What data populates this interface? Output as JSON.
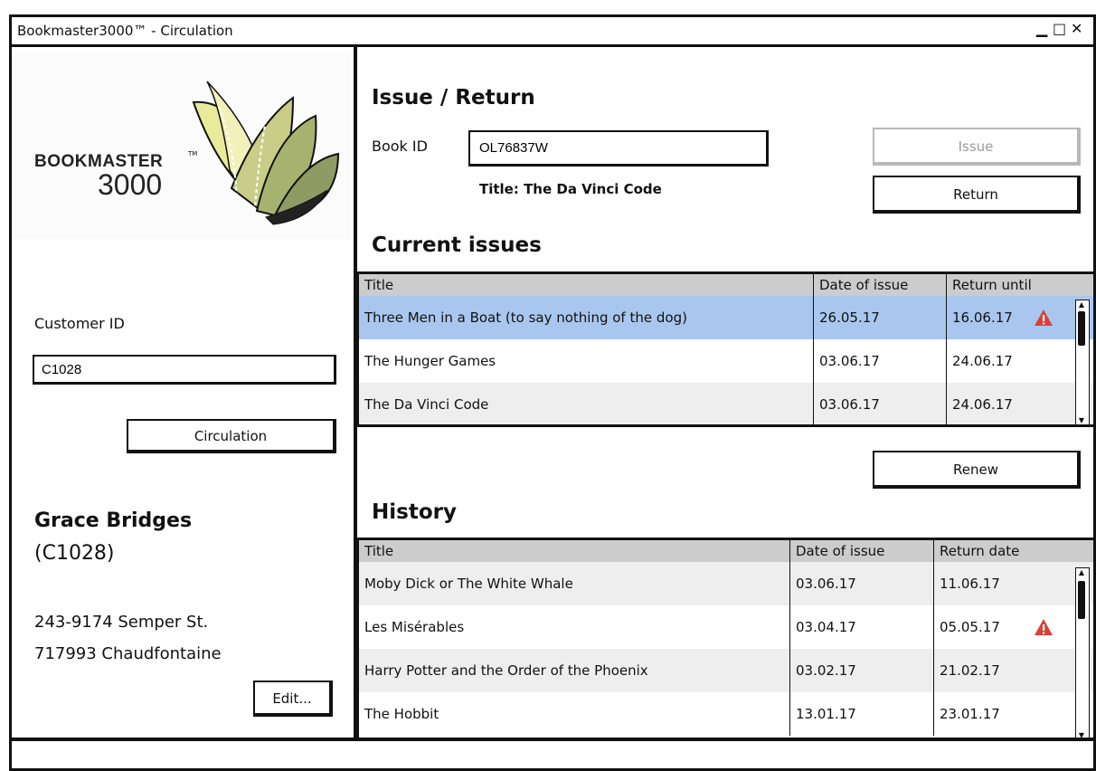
{
  "window": {
    "title": "Bookmaster3000™ - Circulation",
    "controls": [
      "▁",
      "□",
      "✕"
    ]
  },
  "logo": {
    "word": "BOOKMASTER",
    "tm": "TM",
    "number": "3000"
  },
  "customer": {
    "id_label": "Customer ID",
    "id_value": "C1028",
    "circulation_button": "Circulation",
    "name": "Grace Bridges",
    "id_display": "(C1028)",
    "address_line1": "243-9174 Semper St.",
    "address_line2": "717993 Chaudfontaine",
    "edit_button": "Edit..."
  },
  "issue_return": {
    "heading": "Issue / Return",
    "book_id_label": "Book ID",
    "book_id_value": "OL76837W",
    "title_text": "Title: The Da Vinci Code",
    "issue_button": "Issue",
    "return_button": "Return"
  },
  "current_issues": {
    "heading": "Current issues",
    "columns": [
      "Title",
      "Date of issue",
      "Return until"
    ],
    "rows": [
      {
        "title": "Three Men in a Boat (to say nothing of the dog)",
        "issued": "26.05.17",
        "due": "16.06.17",
        "overdue": true,
        "selected": true
      },
      {
        "title": "The Hunger Games",
        "issued": "03.06.17",
        "due": "24.06.17",
        "overdue": false,
        "selected": false
      },
      {
        "title": "The Da Vinci Code",
        "issued": "03.06.17",
        "due": "24.06.17",
        "overdue": false,
        "selected": false
      }
    ],
    "renew_button": "Renew"
  },
  "history": {
    "heading": "History",
    "columns": [
      "Title",
      "Date of issue",
      "Return date"
    ],
    "rows": [
      {
        "title": "Moby Dick or The White Whale",
        "issued": "03.06.17",
        "returned": "11.06.17",
        "overdue": false
      },
      {
        "title": "Les Misérables",
        "issued": "03.04.17",
        "returned": "05.05.17",
        "overdue": true
      },
      {
        "title": "Harry Potter and the Order of the Phoenix",
        "issued": "03.02.17",
        "returned": "21.02.17",
        "overdue": false
      },
      {
        "title": "The Hobbit",
        "issued": "13.01.17",
        "returned": "23.01.17",
        "overdue": false
      }
    ]
  },
  "colors": {
    "selected_row": "#a9c7ee",
    "header_bg": "#cccccc",
    "alt_row": "#eeeeee",
    "warning": "#d9403a"
  },
  "icons": {
    "warning": "warning-triangle-icon"
  }
}
